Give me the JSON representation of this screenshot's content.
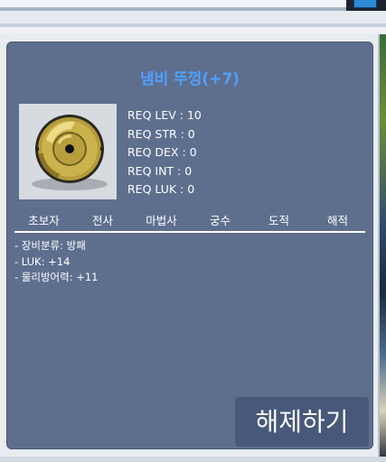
{
  "item": {
    "name": "냄비 뚜껑(+7)",
    "icon": "pot-lid-shield-icon",
    "requirements": [
      "REQ LEV : 10",
      "REQ STR : 0",
      "REQ DEX : 0",
      "REQ INT : 0",
      "REQ LUK : 0"
    ],
    "jobs": [
      "초보자",
      "전사",
      "마법사",
      "궁수",
      "도적",
      "해적"
    ],
    "stats": [
      "- 장비분류: 방패",
      "- LUK: +14",
      "- 물리방어력: +11"
    ]
  },
  "actions": {
    "release_label": "해제하기"
  },
  "colors": {
    "panel_bg": "#5e6f8e",
    "title": "#4fa0ff",
    "button_bg": "#48587a",
    "text": "#ffffff"
  }
}
